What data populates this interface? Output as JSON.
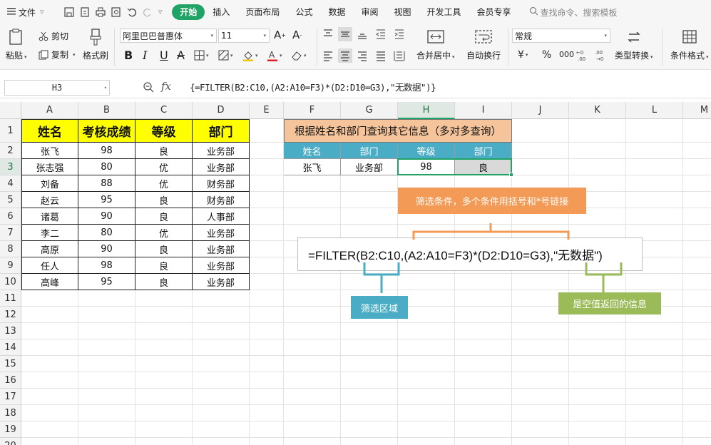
{
  "menubar": {
    "file_label": "文件",
    "tabs": [
      "开始",
      "插入",
      "页面布局",
      "公式",
      "数据",
      "审阅",
      "视图",
      "开发工具",
      "会员专享"
    ],
    "active_tab": "开始",
    "search_placeholder": "查找命令、搜索模板"
  },
  "ribbon": {
    "paste": "粘贴",
    "cut": "剪切",
    "copy": "复制",
    "format_painter": "格式刷",
    "font_name": "阿里巴巴普惠体",
    "font_size": "11",
    "bold": "B",
    "italic": "I",
    "underline": "U",
    "strike": "A",
    "merge_center": "合并居中",
    "wrap_text": "自动换行",
    "number_format": "常规",
    "currency": "¥",
    "percent": "%",
    "thousands": "000",
    "type_convert": "类型转换",
    "conditional_format": "条件格式"
  },
  "formula_bar": {
    "name_box": "H3",
    "fx": "fx",
    "formula": "{=FILTER(B2:C10,(A2:A10=F3)*(D2:D10=G3),\"无数据\")}"
  },
  "sheet": {
    "columns": [
      "A",
      "B",
      "C",
      "D",
      "E",
      "F",
      "G",
      "H",
      "I",
      "J",
      "K",
      "L",
      "M"
    ],
    "rows": [
      "1",
      "2",
      "3",
      "4",
      "5",
      "6",
      "7",
      "8",
      "9",
      "10",
      "11",
      "12",
      "13",
      "14",
      "15",
      "16",
      "17",
      "18",
      "19",
      "20"
    ],
    "selected_column": "H",
    "selected_row": "3",
    "source_headers": [
      "姓名",
      "考核成绩",
      "等级",
      "部门"
    ],
    "source_rows": [
      [
        "张飞",
        "98",
        "良",
        "业务部"
      ],
      [
        "张志强",
        "80",
        "优",
        "业务部"
      ],
      [
        "刘备",
        "88",
        "优",
        "财务部"
      ],
      [
        "赵云",
        "95",
        "良",
        "财务部"
      ],
      [
        "诸葛",
        "90",
        "良",
        "人事部"
      ],
      [
        "李二",
        "80",
        "优",
        "业务部"
      ],
      [
        "高原",
        "90",
        "良",
        "业务部"
      ],
      [
        "任人",
        "98",
        "良",
        "业务部"
      ],
      [
        "高峰",
        "95",
        "良",
        "业务部"
      ]
    ],
    "query_title": "根据姓名和部门查询其它信息（多对多查询）",
    "query_headers": [
      "姓名",
      "部门",
      "等级",
      "部门"
    ],
    "query_row": [
      "张飞",
      "业务部",
      "98",
      "良"
    ]
  },
  "annotations": {
    "criteria_note": "筛选条件，多个条件用括号和*号链接",
    "formula_display": "=FILTER(B2:C10,(A2:A10=F3)*(D2:D10=G3),\"无数据\")",
    "range_note": "筛选区域",
    "empty_note": "是空值返回的信息"
  },
  "colors": {
    "accent_green": "#21a366",
    "header_yellow": "#ffff00",
    "title_orange": "#f5c49a",
    "header_blue": "#4bacc6",
    "note_orange": "#f39b56",
    "note_green": "#9bbb59"
  }
}
